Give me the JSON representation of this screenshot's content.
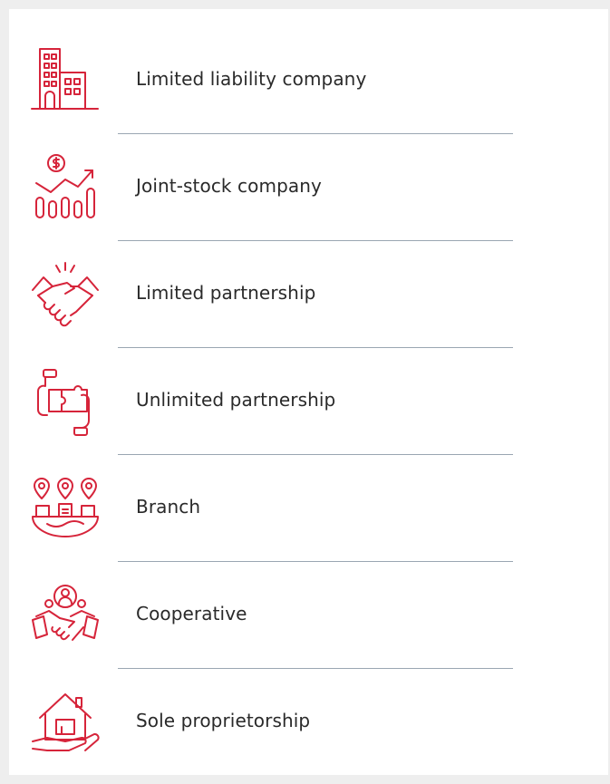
{
  "theme": {
    "accent": "#d6243a",
    "divider": "#9aa6b2",
    "text": "#2a2a2a",
    "background": "#eeeeee",
    "card": "#ffffff"
  },
  "items": [
    {
      "label": "Limited liability company",
      "icon": "office-building-icon"
    },
    {
      "label": "Joint-stock company",
      "icon": "stock-growth-icon"
    },
    {
      "label": "Limited partnership",
      "icon": "handshake-icon"
    },
    {
      "label": "Unlimited partnership",
      "icon": "puzzle-hands-icon"
    },
    {
      "label": "Branch",
      "icon": "branch-locations-icon"
    },
    {
      "label": "Cooperative",
      "icon": "cooperative-handshake-icon"
    },
    {
      "label": "Sole proprietorship",
      "icon": "house-in-hand-icon"
    }
  ]
}
